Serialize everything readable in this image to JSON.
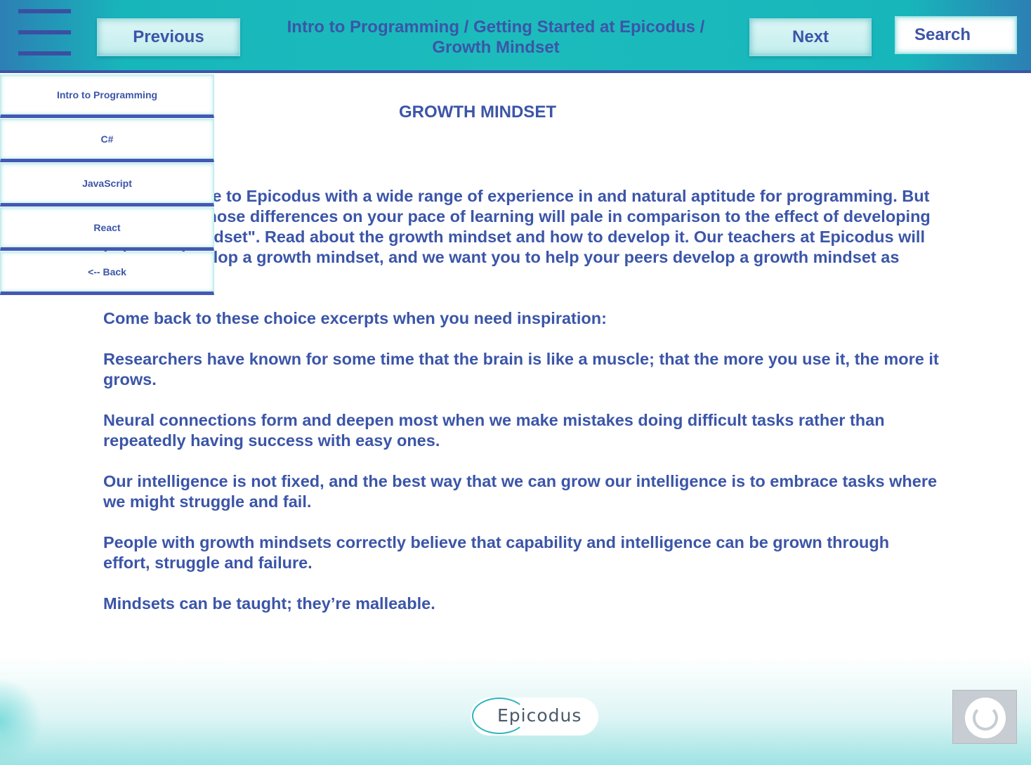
{
  "header": {
    "previous_label": "Previous",
    "next_label": "Next",
    "search_placeholder": "Search",
    "breadcrumb_line1": "Intro to Programming / Getting Started at Epicodus /",
    "breadcrumb_line2": "Growth Mindset"
  },
  "side_menu": {
    "items": [
      {
        "label": "Intro to Programming"
      },
      {
        "label": "C#"
      },
      {
        "label": "JavaScript"
      },
      {
        "label": "React"
      },
      {
        "label": "<-- Back"
      }
    ]
  },
  "main": {
    "title": "GROWTH MINDSET",
    "paragraphs": [
      "Students come to Epicodus with a wide range of experience in and natural aptitude for programming. But the effect of those differences on your pace of learning will pale in comparison to the effect of developing a \"growth mindset\". Read about the growth mindset and how to develop it. Our teachers at Epicodus will help you develop a growth mindset, and we want you to help your peers develop a growth mindset as well.",
      "Come back to these choice excerpts when you need inspiration:",
      "Researchers have known for some time that the brain is like a muscle; that the more you use it, the more it grows.",
      "Neural connections form and deepen most when we make mistakes doing difficult tasks rather than repeatedly having success with easy ones.",
      "Our intelligence is not fixed, and the best way that we can grow our intelligence is to embrace tasks where we might struggle and fail.",
      "People with growth mindsets correctly believe that capability and intelligence can be grown through effort, struggle and failure.",
      "Mindsets can be taught; they’re malleable."
    ]
  },
  "footer": {
    "logo_text": "Epicodus"
  },
  "icons": {
    "menu": "hamburger-icon",
    "corner": "circle-icon"
  },
  "colors": {
    "header_teal": "#17b6bb",
    "text_blue": "#3b55a8"
  }
}
